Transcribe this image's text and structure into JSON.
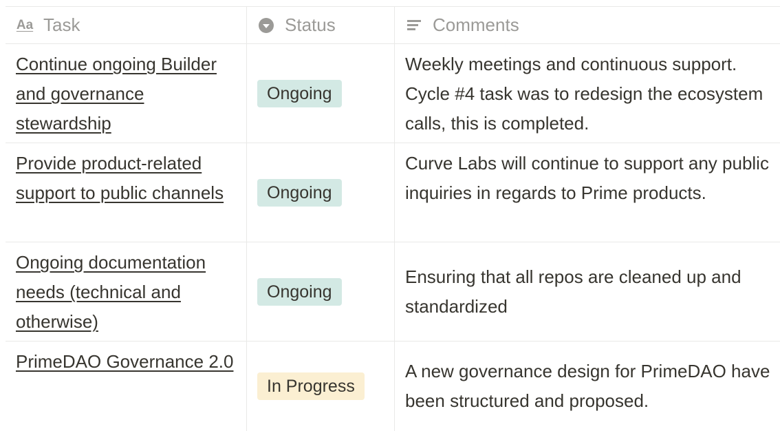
{
  "header": {
    "task_label": "Task",
    "task_icon": "Aa",
    "status_label": "Status",
    "comments_label": "Comments"
  },
  "colors": {
    "ongoing_badge": "#d3e9e4",
    "in_progress_badge": "#fbefd2"
  },
  "rows": [
    {
      "task": "Continue ongoing Builder and governance stewardship",
      "status": "Ongoing",
      "comment": "Weekly meetings and continuous support. Cycle #4 task was to redesign the ecosystem calls, this is completed."
    },
    {
      "task": "Provide product-related support to public channels",
      "status": "Ongoing",
      "comment": "Curve Labs will continue to support any public inquiries in regards to Prime products."
    },
    {
      "task": "Ongoing documentation needs (technical and otherwise)",
      "status": "Ongoing",
      "comment": "Ensuring that all repos are cleaned up and standardized"
    },
    {
      "task": "PrimeDAO Governance 2.0",
      "status": "In Progress",
      "comment": "A new governance design for PrimeDAO have been structured and proposed."
    }
  ]
}
